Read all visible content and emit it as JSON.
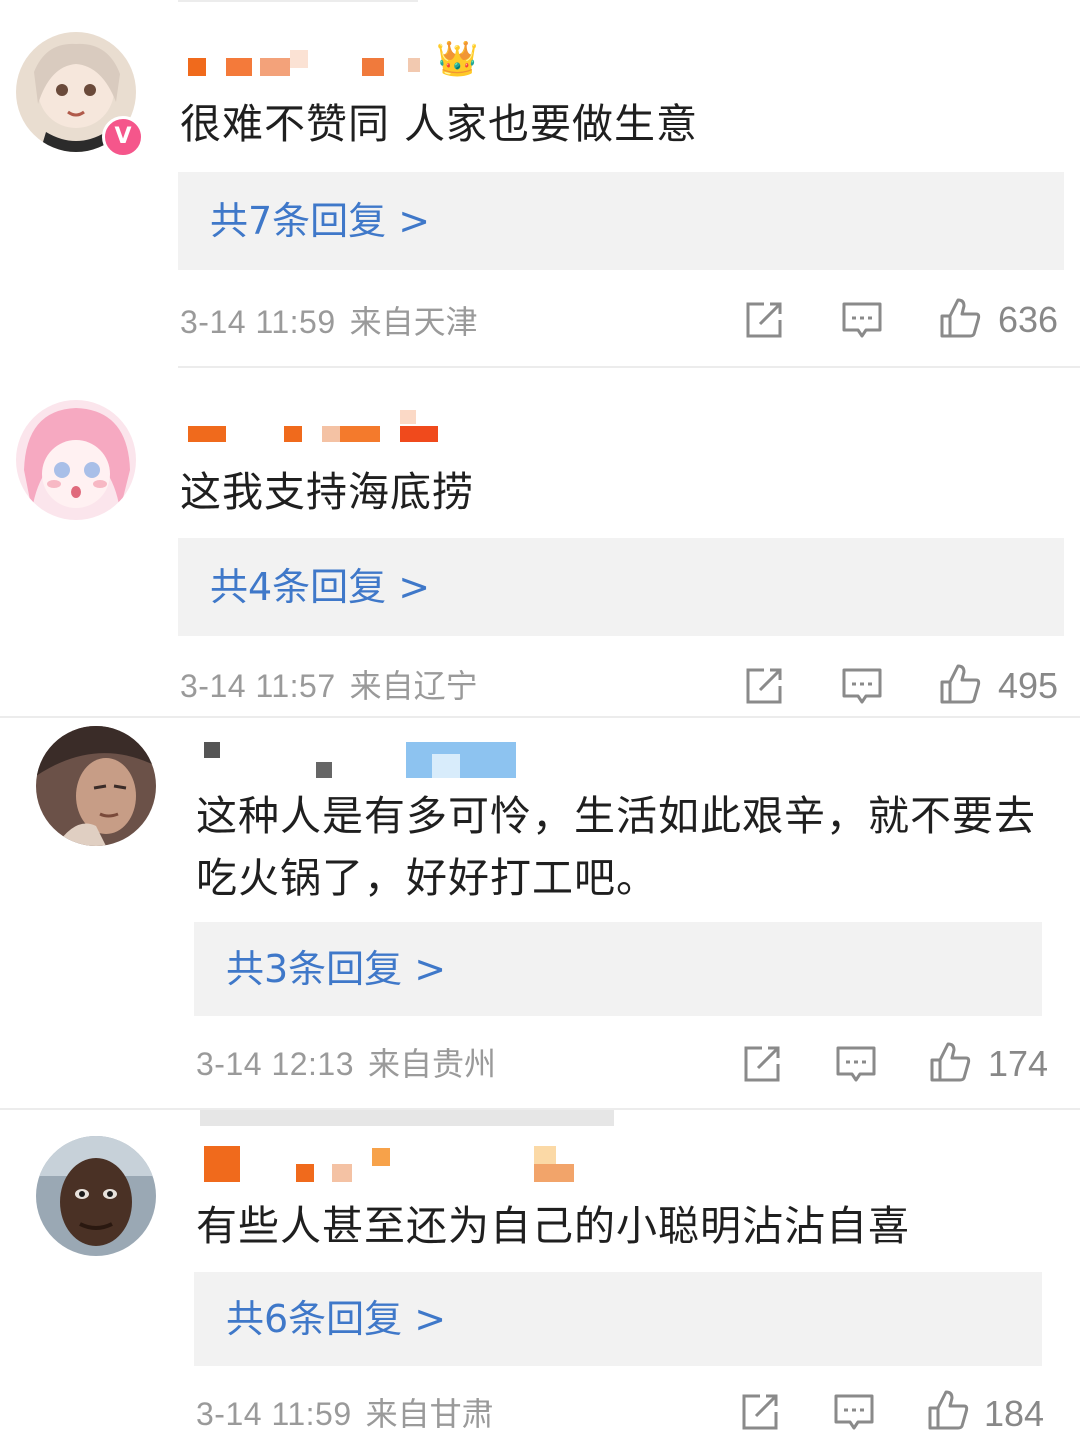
{
  "colors": {
    "link": "#3f78c9",
    "meta": "#9a9a9a",
    "reply_bg": "#f2f2f2",
    "badge": "#f5568b"
  },
  "icons": {
    "share": "share-icon",
    "comment": "comment-icon",
    "like": "thumbs-up-icon",
    "vip": "vip-badge-icon",
    "crown": "crown-icon"
  },
  "comments": [
    {
      "text": "很难不赞同 人家也要做生意",
      "replies": "共7条回复 >",
      "time": "3-14 11:59",
      "location": "来自天津",
      "likes": "636",
      "crown": "👑"
    },
    {
      "text": "这我支持海底捞",
      "replies": "共4条回复 >",
      "time": "3-14 11:57",
      "location": "来自辽宁",
      "likes": "495"
    },
    {
      "text_lines": [
        "这种人是有多可怜，生活如此艰辛，就不要去",
        "吃火锅了，好好打工吧。"
      ],
      "replies": "共3条回复 >",
      "time": "3-14 12:13",
      "location": "来自贵州",
      "likes": "174"
    },
    {
      "text": "有些人甚至还为自己的小聪明沾沾自喜",
      "replies": "共6条回复 >",
      "time": "3-14 11:59",
      "location": "来自甘肃",
      "likes": "184"
    }
  ]
}
